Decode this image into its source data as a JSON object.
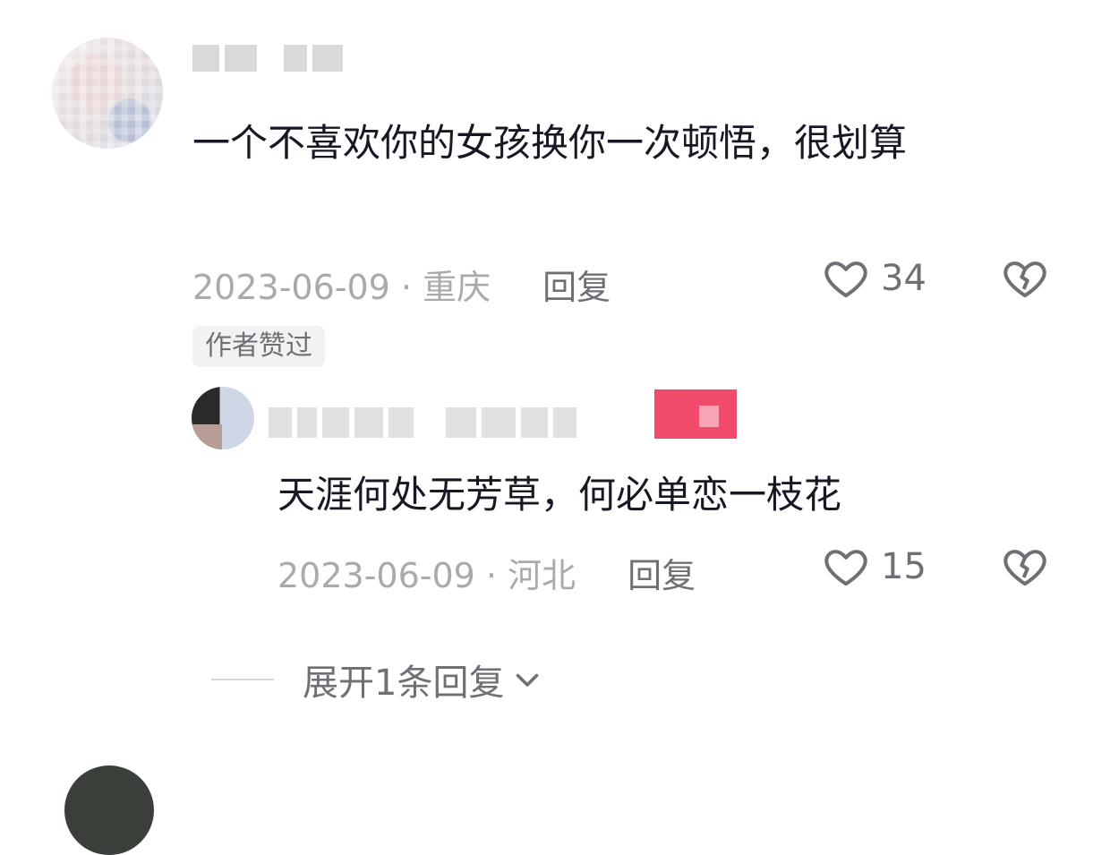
{
  "comment": {
    "text": "一个不喜欢你的女孩换你一次顿悟，很划算",
    "date_location": "2023-06-09 · 重庆",
    "reply_label": "回复",
    "likes": "34",
    "author_liked_label": "作者赞过"
  },
  "reply": {
    "text": "天涯何处无芳草，何必单恋一枝花",
    "date_location": "2023-06-09 · 河北",
    "reply_label": "回复",
    "likes": "15"
  },
  "expand": {
    "label": "展开1条回复"
  },
  "icons": {
    "like": "heart-icon",
    "dislike": "broken-heart-icon",
    "expand": "chevron-down-icon"
  },
  "colors": {
    "text_primary": "#161823",
    "text_secondary": "#a9aaae",
    "icon_gray": "#6f7075",
    "badge_bg": "#f2f2f4"
  }
}
